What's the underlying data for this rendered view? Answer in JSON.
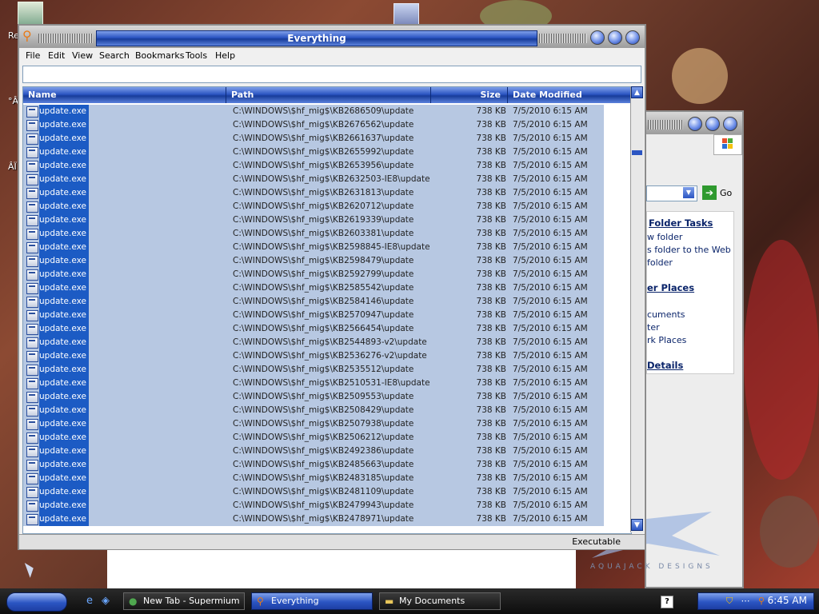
{
  "desktop": {
    "recycle_bin_label": "Re",
    "side_label_1": "°Â",
    "side_label_2": "ÂÏ"
  },
  "everything_window": {
    "title": "Everything",
    "menu": [
      "File",
      "Edit",
      "View",
      "Search",
      "Bookmarks",
      "Tools",
      "Help"
    ],
    "search_value": "",
    "columns": [
      "Name",
      "Path",
      "Size",
      "Date Modified"
    ],
    "rows": [
      {
        "name": "update.exe",
        "path": "C:\\WINDOWS\\$hf_mig$\\KB2686509\\update",
        "size": "738 KB",
        "date": "7/5/2010 6:15 AM"
      },
      {
        "name": "update.exe",
        "path": "C:\\WINDOWS\\$hf_mig$\\KB2676562\\update",
        "size": "738 KB",
        "date": "7/5/2010 6:15 AM"
      },
      {
        "name": "update.exe",
        "path": "C:\\WINDOWS\\$hf_mig$\\KB2661637\\update",
        "size": "738 KB",
        "date": "7/5/2010 6:15 AM"
      },
      {
        "name": "update.exe",
        "path": "C:\\WINDOWS\\$hf_mig$\\KB2655992\\update",
        "size": "738 KB",
        "date": "7/5/2010 6:15 AM"
      },
      {
        "name": "update.exe",
        "path": "C:\\WINDOWS\\$hf_mig$\\KB2653956\\update",
        "size": "738 KB",
        "date": "7/5/2010 6:15 AM"
      },
      {
        "name": "update.exe",
        "path": "C:\\WINDOWS\\$hf_mig$\\KB2632503-IE8\\update",
        "size": "738 KB",
        "date": "7/5/2010 6:15 AM"
      },
      {
        "name": "update.exe",
        "path": "C:\\WINDOWS\\$hf_mig$\\KB2631813\\update",
        "size": "738 KB",
        "date": "7/5/2010 6:15 AM"
      },
      {
        "name": "update.exe",
        "path": "C:\\WINDOWS\\$hf_mig$\\KB2620712\\update",
        "size": "738 KB",
        "date": "7/5/2010 6:15 AM"
      },
      {
        "name": "update.exe",
        "path": "C:\\WINDOWS\\$hf_mig$\\KB2619339\\update",
        "size": "738 KB",
        "date": "7/5/2010 6:15 AM"
      },
      {
        "name": "update.exe",
        "path": "C:\\WINDOWS\\$hf_mig$\\KB2603381\\update",
        "size": "738 KB",
        "date": "7/5/2010 6:15 AM"
      },
      {
        "name": "update.exe",
        "path": "C:\\WINDOWS\\$hf_mig$\\KB2598845-IE8\\update",
        "size": "738 KB",
        "date": "7/5/2010 6:15 AM"
      },
      {
        "name": "update.exe",
        "path": "C:\\WINDOWS\\$hf_mig$\\KB2598479\\update",
        "size": "738 KB",
        "date": "7/5/2010 6:15 AM"
      },
      {
        "name": "update.exe",
        "path": "C:\\WINDOWS\\$hf_mig$\\KB2592799\\update",
        "size": "738 KB",
        "date": "7/5/2010 6:15 AM"
      },
      {
        "name": "update.exe",
        "path": "C:\\WINDOWS\\$hf_mig$\\KB2585542\\update",
        "size": "738 KB",
        "date": "7/5/2010 6:15 AM"
      },
      {
        "name": "update.exe",
        "path": "C:\\WINDOWS\\$hf_mig$\\KB2584146\\update",
        "size": "738 KB",
        "date": "7/5/2010 6:15 AM"
      },
      {
        "name": "update.exe",
        "path": "C:\\WINDOWS\\$hf_mig$\\KB2570947\\update",
        "size": "738 KB",
        "date": "7/5/2010 6:15 AM"
      },
      {
        "name": "update.exe",
        "path": "C:\\WINDOWS\\$hf_mig$\\KB2566454\\update",
        "size": "738 KB",
        "date": "7/5/2010 6:15 AM"
      },
      {
        "name": "update.exe",
        "path": "C:\\WINDOWS\\$hf_mig$\\KB2544893-v2\\update",
        "size": "738 KB",
        "date": "7/5/2010 6:15 AM"
      },
      {
        "name": "update.exe",
        "path": "C:\\WINDOWS\\$hf_mig$\\KB2536276-v2\\update",
        "size": "738 KB",
        "date": "7/5/2010 6:15 AM"
      },
      {
        "name": "update.exe",
        "path": "C:\\WINDOWS\\$hf_mig$\\KB2535512\\update",
        "size": "738 KB",
        "date": "7/5/2010 6:15 AM"
      },
      {
        "name": "update.exe",
        "path": "C:\\WINDOWS\\$hf_mig$\\KB2510531-IE8\\update",
        "size": "738 KB",
        "date": "7/5/2010 6:15 AM"
      },
      {
        "name": "update.exe",
        "path": "C:\\WINDOWS\\$hf_mig$\\KB2509553\\update",
        "size": "738 KB",
        "date": "7/5/2010 6:15 AM"
      },
      {
        "name": "update.exe",
        "path": "C:\\WINDOWS\\$hf_mig$\\KB2508429\\update",
        "size": "738 KB",
        "date": "7/5/2010 6:15 AM"
      },
      {
        "name": "update.exe",
        "path": "C:\\WINDOWS\\$hf_mig$\\KB2507938\\update",
        "size": "738 KB",
        "date": "7/5/2010 6:15 AM"
      },
      {
        "name": "update.exe",
        "path": "C:\\WINDOWS\\$hf_mig$\\KB2506212\\update",
        "size": "738 KB",
        "date": "7/5/2010 6:15 AM"
      },
      {
        "name": "update.exe",
        "path": "C:\\WINDOWS\\$hf_mig$\\KB2492386\\update",
        "size": "738 KB",
        "date": "7/5/2010 6:15 AM"
      },
      {
        "name": "update.exe",
        "path": "C:\\WINDOWS\\$hf_mig$\\KB2485663\\update",
        "size": "738 KB",
        "date": "7/5/2010 6:15 AM"
      },
      {
        "name": "update.exe",
        "path": "C:\\WINDOWS\\$hf_mig$\\KB2483185\\update",
        "size": "738 KB",
        "date": "7/5/2010 6:15 AM"
      },
      {
        "name": "update.exe",
        "path": "C:\\WINDOWS\\$hf_mig$\\KB2481109\\update",
        "size": "738 KB",
        "date": "7/5/2010 6:15 AM"
      },
      {
        "name": "update.exe",
        "path": "C:\\WINDOWS\\$hf_mig$\\KB2479943\\update",
        "size": "738 KB",
        "date": "7/5/2010 6:15 AM"
      },
      {
        "name": "update.exe",
        "path": "C:\\WINDOWS\\$hf_mig$\\KB2478971\\update",
        "size": "738 KB",
        "date": "7/5/2010 6:15 AM"
      }
    ],
    "status": "Executable"
  },
  "documents_window": {
    "go_label": "Go",
    "folder_tasks_heading": "Folder Tasks",
    "folder_tasks": [
      "w folder",
      "s folder to the Web",
      "folder"
    ],
    "other_places_heading": "er Places",
    "other_places": [
      "cuments",
      "ter",
      "rk Places"
    ],
    "details_heading": "Details",
    "brand_text": "AQUAJACK DESIGNS"
  },
  "taskbar": {
    "tasks": [
      {
        "label": "New Tab - Supermium",
        "active": false
      },
      {
        "label": "Everything",
        "active": true
      },
      {
        "label": "My Documents",
        "active": false
      }
    ],
    "clock": "6:45 AM"
  },
  "colors": {
    "accent_blue": "#2b55c2",
    "selection_blue": "#1c5bc4",
    "row_highlight": "#b7c8e2"
  }
}
